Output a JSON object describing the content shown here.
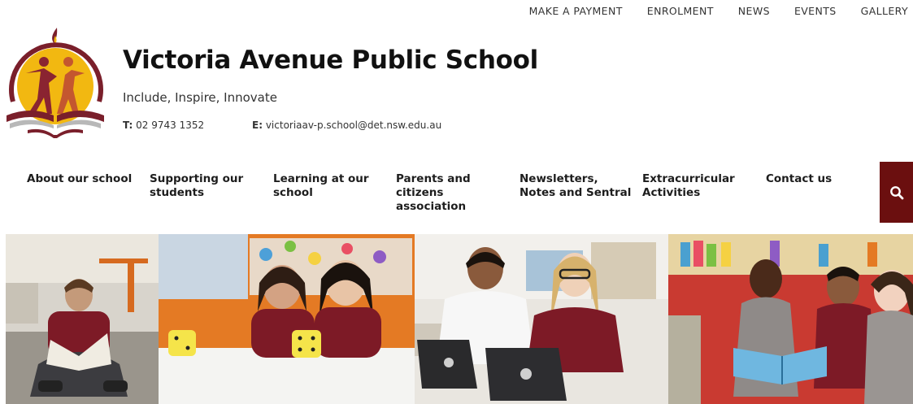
{
  "utility_nav": [
    "MAKE A PAYMENT",
    "ENROLMENT",
    "NEWS",
    "EVENTS",
    "GALLERY"
  ],
  "header": {
    "school_name": "Victoria Avenue Public School",
    "motto": "Include, Inspire, Innovate",
    "phone_label": "T:",
    "phone": "02 9743 1352",
    "email_label": "E:",
    "email": "victoriaav-p.school@det.nsw.edu.au"
  },
  "main_nav": [
    {
      "line1": "About our school",
      "line2": "",
      "line3": ""
    },
    {
      "line1": "Supporting our",
      "line2": "students",
      "line3": ""
    },
    {
      "line1": "Learning at our",
      "line2": "school",
      "line3": ""
    },
    {
      "line1": "Parents and",
      "line2": "citizens",
      "line3": "association"
    },
    {
      "line1": "Newsletters,",
      "line2": "Notes and Sentral",
      "line3": ""
    },
    {
      "line1": "Extracurricular",
      "line2": "Activities",
      "line3": ""
    },
    {
      "line1": "Contact us",
      "line2": "",
      "line3": ""
    }
  ],
  "icons": {
    "search": "search-icon",
    "logo": "school-crest-logo"
  },
  "colors": {
    "brand_maroon": "#6b0f0f",
    "crest_gold": "#f2b811",
    "crest_maroon": "#7a1f2b",
    "uniform_maroon": "#7d1a26"
  },
  "hero_images": [
    "boy-reading-on-floor-photo",
    "two-girls-with-dice-photo",
    "students-with-laptops-photo",
    "girls-reading-book-photo"
  ]
}
